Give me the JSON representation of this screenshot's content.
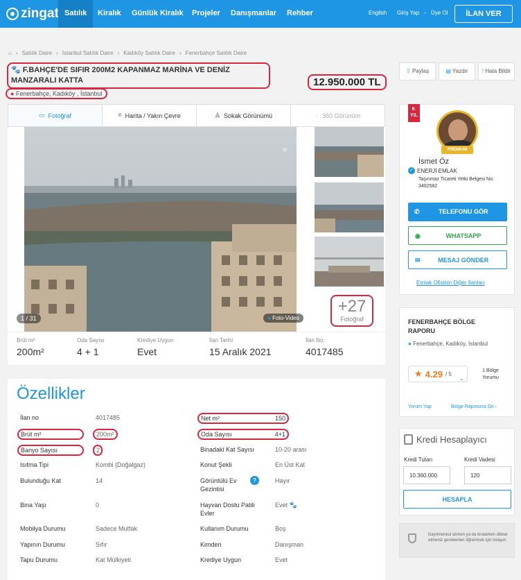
{
  "nav": {
    "logo": "zingat",
    "items": [
      "Satılık",
      "Kiralık",
      "Günlük Kiralık",
      "Projeler",
      "Danışmanlar",
      "Rehber"
    ],
    "lang": "English",
    "login": "Giriş Yap",
    "sep": "-",
    "register": "Üye Ol",
    "cta": "İLAN VER"
  },
  "breadcrumb": [
    "Satılık Daire",
    "İstanbul Satılık Daire",
    "Kadıköy Satılık Daire",
    "Fenerbahçe Satılık Daire"
  ],
  "listing": {
    "title": "F.BAHÇE'DE SIFIR 200M2 KAPANMAZ MARİNA VE DENİZ MANZARALI KATTA",
    "location": "Fenerbahçe, Kadıköy , İstanbul",
    "price": "12.950.000 TL"
  },
  "actions": {
    "share": "Paylaş",
    "print": "Yazdır",
    "report": "Hata Bildir"
  },
  "tabs": [
    "Fotoğraf",
    "Harita / Yakın Çevre",
    "Sokak Görünümü",
    "360 Görünüm"
  ],
  "gallery": {
    "counter": "1 / 31",
    "video": "Foto-Video",
    "more_count": "+27",
    "more_label": "Fotoğraf"
  },
  "stats": [
    {
      "label": "Brüt m²",
      "value": "200m²"
    },
    {
      "label": "Oda Sayısı",
      "value": "4 + 1"
    },
    {
      "label": "Krediye Uygun",
      "value": "Evet"
    },
    {
      "label": "İlan Tarihi",
      "value": "15 Aralık 2021"
    },
    {
      "label": "İlan No:",
      "value": "4017485"
    }
  ],
  "features": {
    "title": "Özellikler",
    "left": [
      {
        "k": "İlan no",
        "v": "4017485"
      },
      {
        "k": "Brüt m²",
        "v": "200m²"
      },
      {
        "k": "Banyo Sayısı",
        "v": "2"
      },
      {
        "k": "Isıtma Tipi",
        "v": "Kombi (Doğalgaz)"
      },
      {
        "k": "Bulunduğu Kat",
        "v": "14"
      },
      {
        "k": "Bina Yaşı",
        "v": "0"
      },
      {
        "k": "Mobilya Durumu",
        "v": "Sadece Mutfak"
      },
      {
        "k": "Yapının Durumu",
        "v": "Sıfır"
      },
      {
        "k": "Tapu Durumu",
        "v": "Kat Mülkiyeti"
      }
    ],
    "right": [
      {
        "k": "Net m²",
        "v": "150"
      },
      {
        "k": "Oda Sayısı",
        "v": "4+1"
      },
      {
        "k": "Binadaki Kat Sayısı",
        "v": "10-20 arası"
      },
      {
        "k": "Konut Şekli",
        "v": "En Üst Kat"
      },
      {
        "k": "Görüntülü Ev Gezintisi",
        "v": "Hayır"
      },
      {
        "k": "Hayvan Dostu Patili Evler",
        "v": "Evet"
      },
      {
        "k": "Kullanım Durumu",
        "v": "Boş"
      },
      {
        "k": "Kimden",
        "v": "Danışman"
      },
      {
        "k": "Krediye Uygun",
        "v": "Evet"
      }
    ]
  },
  "agent": {
    "years": "6.",
    "years_unit": "YIL",
    "badge": "PREMIUM",
    "name": "İsmet Öz",
    "agency": "ENERJİ EMLAK",
    "license": "Taşınmaz Ticareti Yetki Belgesi No: 3402582",
    "phone": "TELEFONU GÖR",
    "whatsapp": "WHATSAPP",
    "message": "MESAJ GÖNDER",
    "other": "Emlak Ofisinin Diğer İlanları"
  },
  "region": {
    "title": "FENERBAHÇE BÖLGE RAPORU",
    "location": "Fenerbahçe, Kadıköy, İstanbul",
    "score": "4.29",
    "max": "/ 5",
    "reviews": "1 Bölge Yorumu",
    "write": "Yorum Yap",
    "go": "Bölge Raporuna Git"
  },
  "credit": {
    "title": "Kredi Hesaplayıcı",
    "amount_label": "Kredi Tutarı",
    "term_label": "Kredi Vadesi",
    "amount": "10.360.000",
    "term": "120",
    "button": "HESAPLA"
  },
  "notice": "Gayrimenkul alırken ya da kiralarken dikkat etmeniz gerekenleri öğrenmek için tıklayın.",
  "colors": {
    "primary": "#1f96e3",
    "highlight": "#d7263d",
    "whatsapp": "#2ea74a",
    "star": "#f07c1c"
  }
}
